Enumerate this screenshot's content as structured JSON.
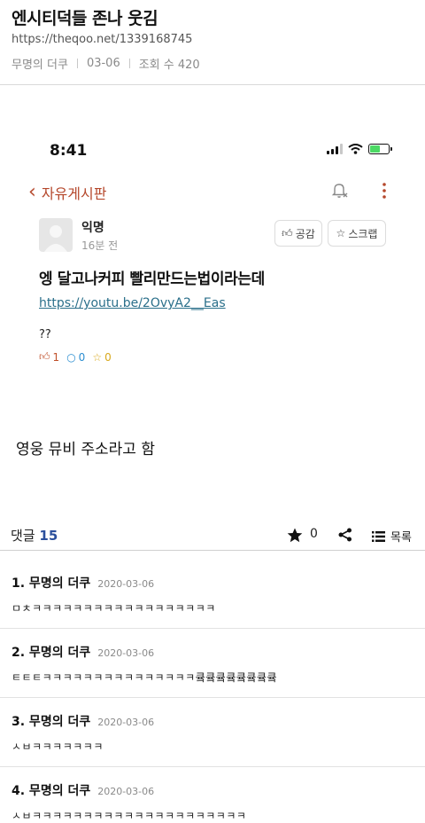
{
  "post": {
    "title": "엔시티덕들 존나 웃김",
    "url": "https://theqoo.net/1339168745",
    "author": "무명의 더쿠",
    "date": "03-06",
    "views": "조회 수 420"
  },
  "screenshot": {
    "time": "8:41",
    "back_label": "자유게시판",
    "author_name": "익명",
    "author_time": "16분 전",
    "like_button": "공감",
    "scrap_button": "스크랩",
    "title": "엥 달고나커피 빨리만드는법이라는데",
    "link": "https://youtu.be/2OvyA2__Eas",
    "body": "??",
    "likes": "1",
    "comments": "0",
    "scraps": "0"
  },
  "caption": "영웅 뮤비 주소라고 함",
  "comment_bar": {
    "label": "댓글",
    "count": "15",
    "star_count": "0",
    "list_label": "목록"
  },
  "comments": [
    {
      "name": "1. 무명의 더쿠",
      "date": "2020-03-06",
      "text": "ㅁㅊㅋㅋㅋㅋㅋㅋㅋㅋㅋㅋㅋㅋㅋㅋㅋㅋㅋㅋ"
    },
    {
      "name": "2. 무명의 더쿠",
      "date": "2020-03-06",
      "text": "ㅌㅌㅌㅋㅋㅋㅋㅋㅋㅋㅋㅋㅋㅋㅋㅋㅋㅋ큨큨큨큨큨큨큨큨"
    },
    {
      "name": "3. 무명의 더쿠",
      "date": "2020-03-06",
      "text": "ㅅㅂㅋㅋㅋㅋㅋㅋㅋ"
    },
    {
      "name": "4. 무명의 더쿠",
      "date": "2020-03-06",
      "text": "ㅅㅂㅋㅋㅋㅋㅋㅋㅋㅋㅋㅋㅋㅋㅋㅋㅋㅋㅋㅋㅋㅋㅋ"
    }
  ],
  "colors": {
    "accent_red": "#b5482c",
    "link_blue": "#2a6f8a",
    "count_blue": "#2b4f9c"
  }
}
